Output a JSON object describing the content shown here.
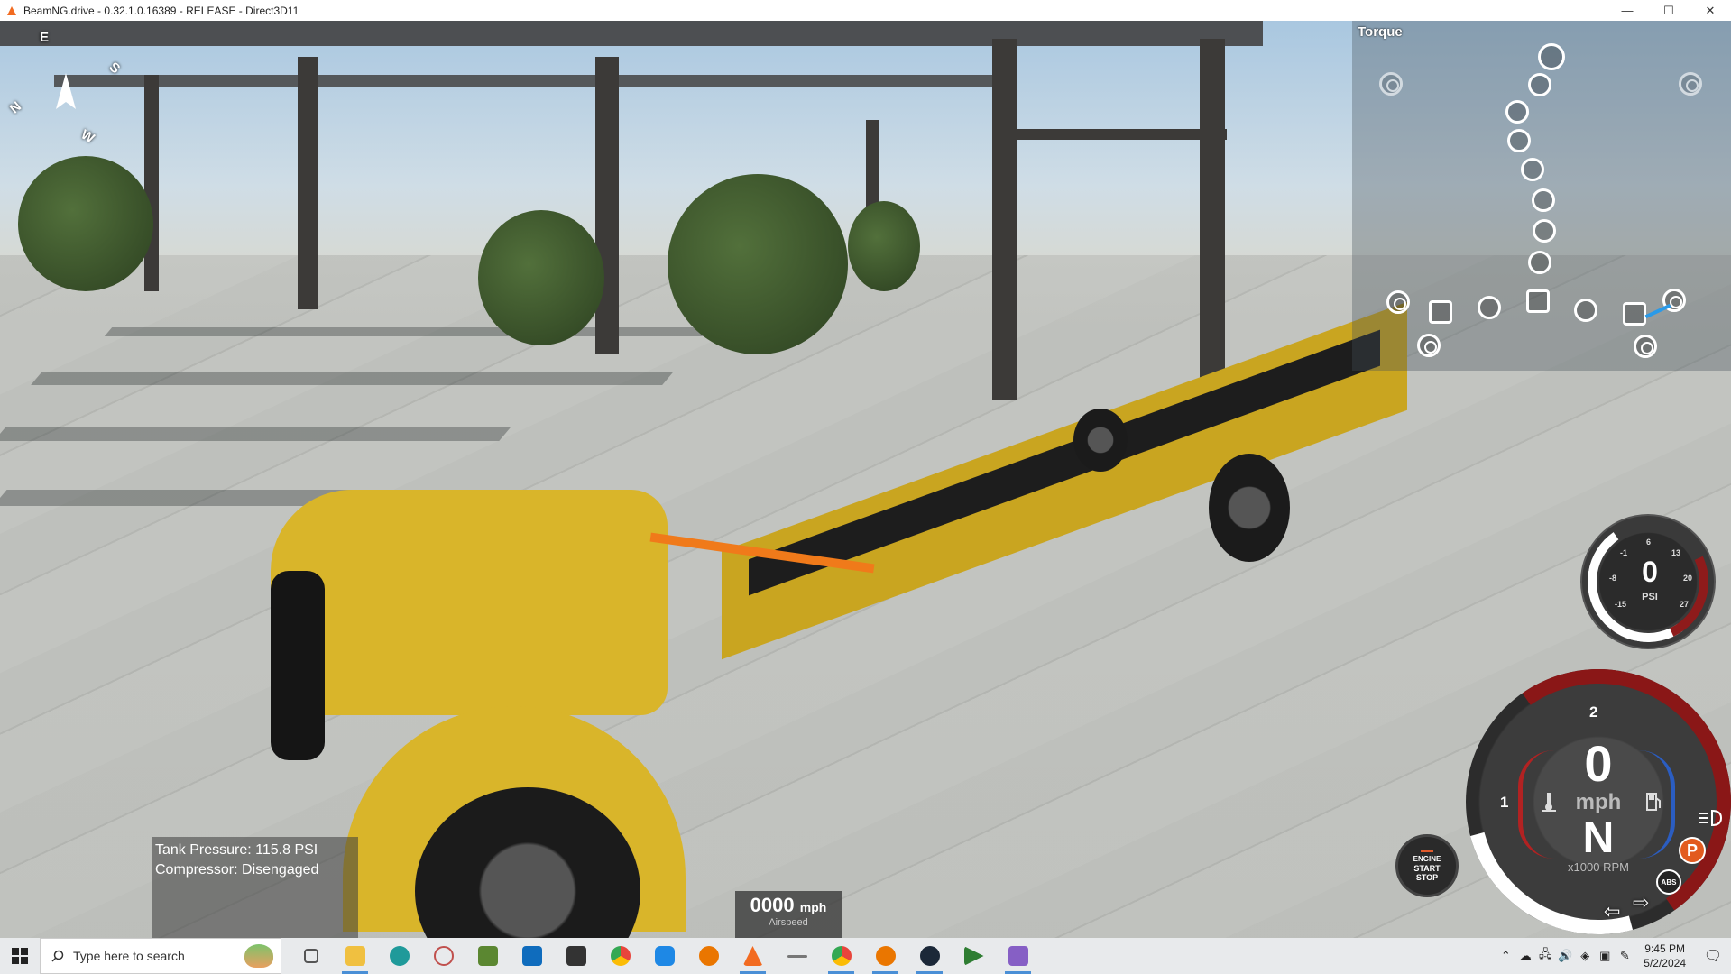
{
  "window": {
    "title": "BeamNG.drive - 0.32.1.0.16389 - RELEASE - Direct3D11",
    "minimize_glyph": "—",
    "maximize_glyph": "☐",
    "close_glyph": "✕"
  },
  "compass": {
    "letters": [
      "E",
      "S",
      "N",
      "W"
    ]
  },
  "torque_panel": {
    "title": "Torque"
  },
  "boost_gauge": {
    "value": "0",
    "unit": "PSI",
    "ticks": [
      "6",
      "-1",
      "13",
      "-8",
      "20",
      "-15",
      "27"
    ]
  },
  "speedometer": {
    "gear": "N",
    "speed": "0",
    "speed_unit": "mph",
    "rpm_unit": "x1000 RPM",
    "rpm_tick_top": "2",
    "rpm_tick_left": "1"
  },
  "engine_button": {
    "line1": "ENGINE",
    "line2": "START",
    "line3": "STOP"
  },
  "indicators": {
    "parking": "P",
    "abs": "ABS"
  },
  "tank_info": {
    "pressure": "Tank Pressure: 115.8 PSI",
    "compressor": "Compressor: Disengaged"
  },
  "airspeed": {
    "value": "0000",
    "unit": "mph",
    "label": "Airspeed"
  },
  "taskbar": {
    "search_placeholder": "Type here to search",
    "time": "9:45 PM",
    "date": "5/2/2024",
    "apps": [
      {
        "name": "task-view",
        "color": "#555"
      },
      {
        "name": "file-explorer",
        "color": "#f0c040"
      },
      {
        "name": "arduino",
        "color": "#1f9a9a"
      },
      {
        "name": "app-swirl",
        "color": "#c0504d"
      },
      {
        "name": "minecraft",
        "color": "#5b8731"
      },
      {
        "name": "outlook",
        "color": "#0f6cbd"
      },
      {
        "name": "app-cube",
        "color": "#333"
      },
      {
        "name": "chrome",
        "color": "#e8453c"
      },
      {
        "name": "app-c",
        "color": "#1e88e5"
      },
      {
        "name": "blender",
        "color": "#ea7600"
      },
      {
        "name": "beamng",
        "color": "#f26b21"
      },
      {
        "name": "app-line",
        "color": "#777"
      },
      {
        "name": "chrome-profile",
        "color": "#34a853"
      },
      {
        "name": "blender-2",
        "color": "#ea7600"
      },
      {
        "name": "steam",
        "color": "#1b2838"
      },
      {
        "name": "app-tri",
        "color": "#2e7d32"
      },
      {
        "name": "visual-studio",
        "color": "#865fc5"
      }
    ]
  },
  "colors": {
    "accent_blue": "#2a9ae8",
    "gauge_red": "#8a1717",
    "parking_orange": "#e25b1f",
    "truck_yellow": "#d9b52a"
  }
}
